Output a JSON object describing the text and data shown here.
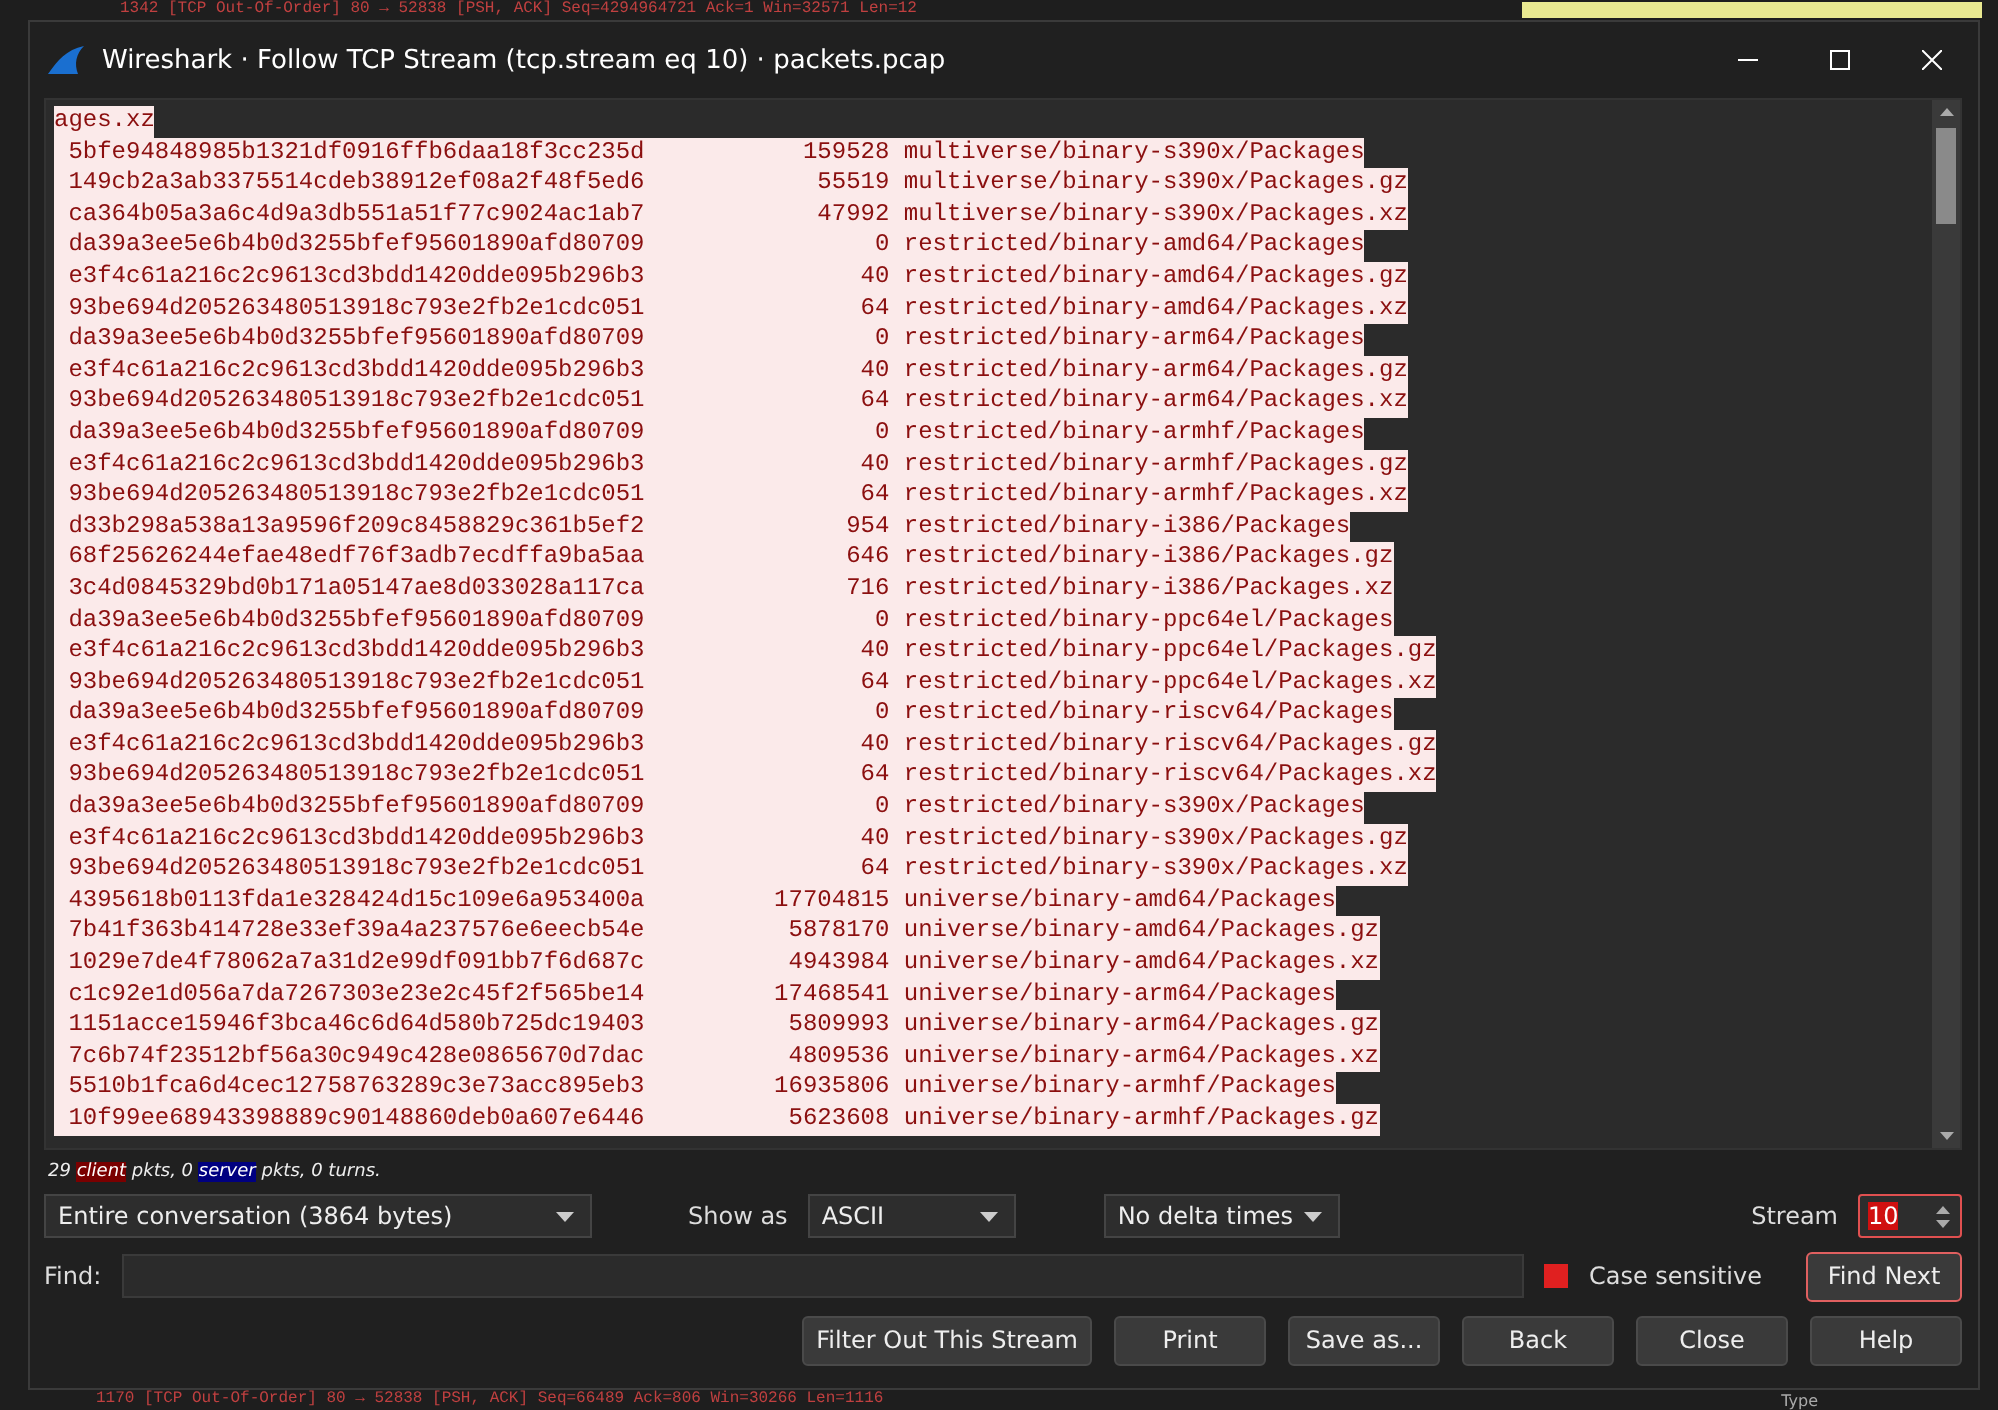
{
  "background": {
    "top_line": "1342 [TCP Out-Of-Order] 80 → 52838 [PSH, ACK] Seq=4294964721 Ack=1 Win=32571 Len=12",
    "bottom_line": "1170 [TCP Out-Of-Order] 80 → 52838 [PSH, ACK] Seq=66489 Ack=806 Win=30266 Len=1116",
    "bottom_right": "Type"
  },
  "window": {
    "title": "Wireshark · Follow TCP Stream (tcp.stream eq 10) · packets.pcap"
  },
  "stream_lines": [
    "ages.xz",
    " 5bfe94848985b1321df0916ffb6daa18f3cc235d           159528 multiverse/binary-s390x/Packages",
    " 149cb2a3ab3375514cdeb38912ef08a2f48f5ed6            55519 multiverse/binary-s390x/Packages.gz",
    " ca364b05a3a6c4d9a3db551a51f77c9024ac1ab7            47992 multiverse/binary-s390x/Packages.xz",
    " da39a3ee5e6b4b0d3255bfef95601890afd80709                0 restricted/binary-amd64/Packages",
    " e3f4c61a216c2c9613cd3bdd1420dde095b296b3               40 restricted/binary-amd64/Packages.gz",
    " 93be694d205263480513918c793e2fb2e1cdc051               64 restricted/binary-amd64/Packages.xz",
    " da39a3ee5e6b4b0d3255bfef95601890afd80709                0 restricted/binary-arm64/Packages",
    " e3f4c61a216c2c9613cd3bdd1420dde095b296b3               40 restricted/binary-arm64/Packages.gz",
    " 93be694d205263480513918c793e2fb2e1cdc051               64 restricted/binary-arm64/Packages.xz",
    " da39a3ee5e6b4b0d3255bfef95601890afd80709                0 restricted/binary-armhf/Packages",
    " e3f4c61a216c2c9613cd3bdd1420dde095b296b3               40 restricted/binary-armhf/Packages.gz",
    " 93be694d205263480513918c793e2fb2e1cdc051               64 restricted/binary-armhf/Packages.xz",
    " d33b298a538a13a9596f209c8458829c361b5ef2              954 restricted/binary-i386/Packages",
    " 68f25626244efae48edf76f3adb7ecdffa9ba5aa              646 restricted/binary-i386/Packages.gz",
    " 3c4d0845329bd0b171a05147ae8d033028a117ca              716 restricted/binary-i386/Packages.xz",
    " da39a3ee5e6b4b0d3255bfef95601890afd80709                0 restricted/binary-ppc64el/Packages",
    " e3f4c61a216c2c9613cd3bdd1420dde095b296b3               40 restricted/binary-ppc64el/Packages.gz",
    " 93be694d205263480513918c793e2fb2e1cdc051               64 restricted/binary-ppc64el/Packages.xz",
    " da39a3ee5e6b4b0d3255bfef95601890afd80709                0 restricted/binary-riscv64/Packages",
    " e3f4c61a216c2c9613cd3bdd1420dde095b296b3               40 restricted/binary-riscv64/Packages.gz",
    " 93be694d205263480513918c793e2fb2e1cdc051               64 restricted/binary-riscv64/Packages.xz",
    " da39a3ee5e6b4b0d3255bfef95601890afd80709                0 restricted/binary-s390x/Packages",
    " e3f4c61a216c2c9613cd3bdd1420dde095b296b3               40 restricted/binary-s390x/Packages.gz",
    " 93be694d205263480513918c793e2fb2e1cdc051               64 restricted/binary-s390x/Packages.xz",
    " 4395618b0113fda1e328424d15c109e6a953400a         17704815 universe/binary-amd64/Packages",
    " 7b41f363b414728e33ef39a4a237576e6eecb54e          5878170 universe/binary-amd64/Packages.gz",
    " 1029e7de4f78062a7a31d2e99df091bb7f6d687c          4943984 universe/binary-amd64/Packages.xz",
    " c1c92e1d056a7da7267303e23e2c45f2f565be14         17468541 universe/binary-arm64/Packages",
    " 1151acce15946f3bca46c6d64d580b725dc19403          5809993 universe/binary-arm64/Packages.gz",
    " 7c6b74f23512bf56a30c949c428e0865670d7dac          4809536 universe/binary-arm64/Packages.xz",
    " 5510b1fca6d4cec12758763289c3e73acc895eb3         16935806 universe/binary-armhf/Packages",
    " 10f99ee68943398889c90148860deb0a607e6446          5623608 universe/binary-armhf/Packages.gz"
  ],
  "status": [
    {
      "kind": "plain",
      "text": "29 "
    },
    {
      "kind": "client",
      "text": "client"
    },
    {
      "kind": "plain",
      "text": " pkts, 0 "
    },
    {
      "kind": "server",
      "text": "server"
    },
    {
      "kind": "plain",
      "text": " pkts, 0 turns."
    }
  ],
  "conversation_dropdown": {
    "value": "Entire conversation (3864 bytes)"
  },
  "show_as": {
    "label": "Show as",
    "value": "ASCII"
  },
  "delta_dropdown": {
    "value": "No delta times"
  },
  "stream": {
    "label": "Stream",
    "value": "10"
  },
  "find": {
    "label": "Find:",
    "case_sensitive": {
      "label": "Case sensitive",
      "checked": true
    },
    "button": "Find Next"
  },
  "buttons": [
    "Filter Out This Stream",
    "Print",
    "Save as...",
    "Back",
    "Close",
    "Help"
  ]
}
